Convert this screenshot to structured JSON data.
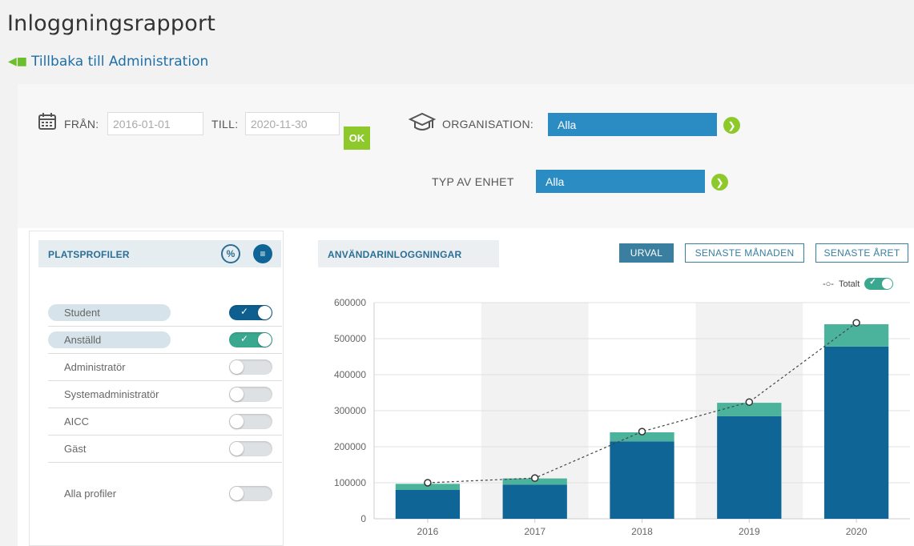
{
  "header": {
    "title": "Inloggningsrapport",
    "back_label": "Tillbaka till Administration"
  },
  "filters": {
    "from_label": "FRÅN:",
    "from_value": "2016-01-01",
    "to_label": "TILL:",
    "to_value": "2020-11-30",
    "ok_label": "OK",
    "org_label": "ORGANISATION:",
    "org_value": "Alla",
    "unit_label": "TYP AV ENHET",
    "unit_value": "Alla"
  },
  "profiles": {
    "title": "PLATSPROFILER",
    "items": [
      {
        "label": "Student",
        "on": true,
        "color": "#0e5f8f"
      },
      {
        "label": "Anställd",
        "on": true,
        "color": "#3aa88f"
      },
      {
        "label": "Administratör",
        "on": false
      },
      {
        "label": "Systemadministratör",
        "on": false
      },
      {
        "label": "AICC",
        "on": false
      },
      {
        "label": "Gäst",
        "on": false
      }
    ],
    "all_label": "Alla profiler"
  },
  "chart_panel": {
    "title": "ANVÄNDARINLOGGNINGAR",
    "tabs": [
      "URVAL",
      "SENASTE MÅNADEN",
      "SENASTE ÅRET"
    ],
    "active_tab": "URVAL",
    "legend_label": "Totalt"
  },
  "colors": {
    "student": "#0e6596",
    "employee": "#4bb39c",
    "accent": "#8ec92b",
    "select": "#2b8cc4"
  },
  "chart_data": {
    "type": "bar",
    "categories": [
      "2016",
      "2017",
      "2018",
      "2019",
      "2020"
    ],
    "series": [
      {
        "name": "Student",
        "values": [
          80000,
          95000,
          215000,
          285000,
          478000
        ]
      },
      {
        "name": "Anställd",
        "values": [
          17000,
          17000,
          25000,
          37000,
          62000
        ]
      },
      {
        "name": "Totalt",
        "values": [
          100000,
          113000,
          242000,
          324000,
          544000
        ]
      }
    ],
    "ylim": [
      0,
      600000
    ],
    "yticks": [
      "0",
      "100000",
      "200000",
      "300000",
      "400000",
      "500000",
      "600000"
    ],
    "stacked": true,
    "line_series": "Totalt",
    "grid": true,
    "legend": "top-right"
  }
}
